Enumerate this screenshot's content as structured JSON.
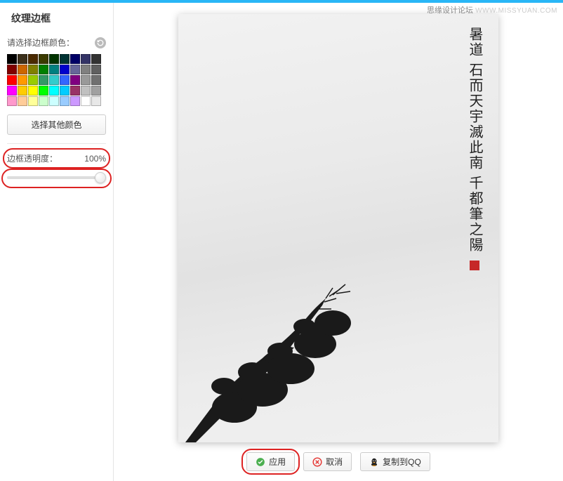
{
  "watermark": {
    "cn": "思缘设计论坛",
    "en": "WWW.MISSYUAN.COM"
  },
  "sidebar": {
    "title": "纹理边框",
    "color_label": "请选择边框颜色：",
    "swatches": [
      "#000000",
      "#3b2f1b",
      "#4a2a00",
      "#3b3b00",
      "#003300",
      "#003333",
      "#000066",
      "#333366",
      "#333333",
      "#800000",
      "#cc6600",
      "#808000",
      "#008000",
      "#008080",
      "#0000cc",
      "#666699",
      "#808080",
      "#606060",
      "#ff0000",
      "#ff9900",
      "#99cc00",
      "#339966",
      "#33cccc",
      "#3366ff",
      "#800080",
      "#999999",
      "#707070",
      "#ff00ff",
      "#ffcc00",
      "#ffff00",
      "#00ff00",
      "#00ffff",
      "#00ccff",
      "#993366",
      "#c0c0c0",
      "#a0a0a0",
      "#ff99cc",
      "#ffcc99",
      "#ffff99",
      "#ccffcc",
      "#ccffff",
      "#99ccff",
      "#cc99ff",
      "#ffffff",
      "#e8e8e8"
    ],
    "other_color_btn": "选择其他颜色",
    "opacity_label": "边框透明度：",
    "opacity_value": "100%"
  },
  "buttons": {
    "apply": "应用",
    "cancel": "取消",
    "copy_qq": "复制到QQ"
  },
  "calligraphy": {
    "line1": "暑道",
    "line2": "石而天宇滅此南",
    "line3": "千都筆之陽"
  }
}
